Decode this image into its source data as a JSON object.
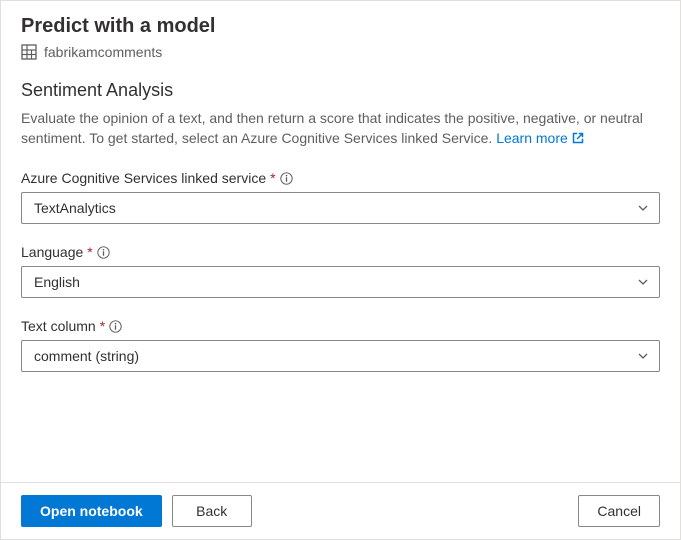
{
  "header": {
    "title": "Predict with a model",
    "resource_name": "fabrikamcomments"
  },
  "section": {
    "title": "Sentiment Analysis",
    "description_part1": "Evaluate the opinion of a text, and then return a score that indicates the positive, negative, or neutral sentiment. To get started, select an Azure Cognitive Services linked Service. ",
    "learn_more_label": "Learn more"
  },
  "fields": {
    "linked_service": {
      "label": "Azure Cognitive Services linked service",
      "value": "TextAnalytics"
    },
    "language": {
      "label": "Language",
      "value": "English"
    },
    "text_column": {
      "label": "Text column",
      "value": "comment (string)"
    }
  },
  "footer": {
    "open_notebook_label": "Open notebook",
    "back_label": "Back",
    "cancel_label": "Cancel"
  }
}
